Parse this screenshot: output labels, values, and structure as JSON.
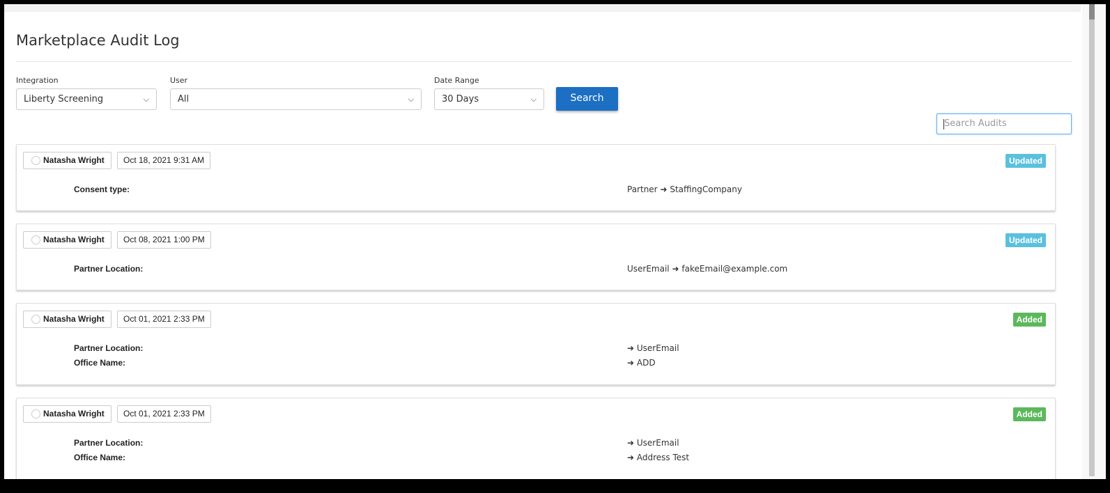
{
  "page": {
    "title": "Marketplace Audit Log"
  },
  "filters": {
    "integration": {
      "label": "Integration",
      "value": "Liberty Screening"
    },
    "user": {
      "label": "User",
      "value": "All"
    },
    "date_range": {
      "label": "Date Range",
      "value": "30 Days"
    },
    "search_button": "Search",
    "search_audits_placeholder": "Search Audits"
  },
  "arrow_glyph": "➜",
  "colors": {
    "updated": "#5bc0de",
    "added": "#5cb85c",
    "primary": "#1c6fc2"
  },
  "audits": [
    {
      "user": "Natasha Wright",
      "date": "Oct 18, 2021 9:31 AM",
      "status": "Updated",
      "changes": [
        {
          "field": "Consent type:",
          "old": "Partner",
          "new": "StaffingCompany"
        }
      ]
    },
    {
      "user": "Natasha Wright",
      "date": "Oct 08, 2021 1:00 PM",
      "status": "Updated",
      "changes": [
        {
          "field": "Partner Location:",
          "old": "UserEmail",
          "new": "fakeEmail@example.com"
        }
      ]
    },
    {
      "user": "Natasha Wright",
      "date": "Oct 01, 2021 2:33 PM",
      "status": "Added",
      "changes": [
        {
          "field": "Partner Location:",
          "old": "",
          "new": "UserEmail"
        },
        {
          "field": "Office Name:",
          "old": "",
          "new": "ADD"
        }
      ]
    },
    {
      "user": "Natasha Wright",
      "date": "Oct 01, 2021 2:33 PM",
      "status": "Added",
      "changes": [
        {
          "field": "Partner Location:",
          "old": "",
          "new": "UserEmail"
        },
        {
          "field": "Office Name:",
          "old": "",
          "new": "Address Test"
        }
      ]
    }
  ]
}
